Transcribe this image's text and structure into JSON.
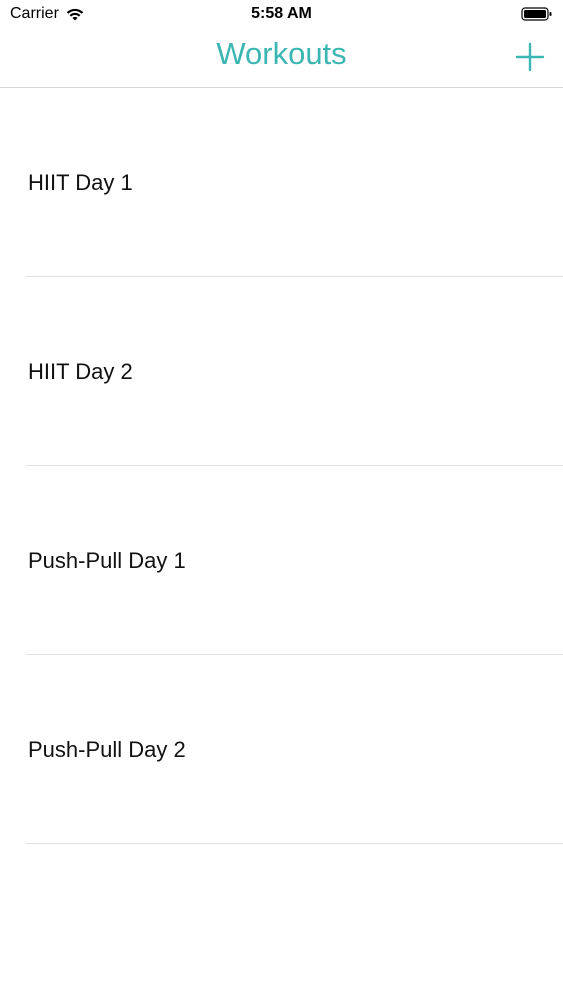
{
  "status_bar": {
    "carrier": "Carrier",
    "time": "5:58 AM",
    "wifi_icon": "wifi-icon",
    "battery_icon": "battery-icon"
  },
  "nav": {
    "title": "Workouts",
    "add_icon": "plus-icon",
    "accent_color": "#3bb6b2"
  },
  "workouts": [
    {
      "label": "HIIT Day 1"
    },
    {
      "label": "HIIT Day 2"
    },
    {
      "label": "Push-Pull Day 1"
    },
    {
      "label": "Push-Pull Day 2"
    }
  ]
}
